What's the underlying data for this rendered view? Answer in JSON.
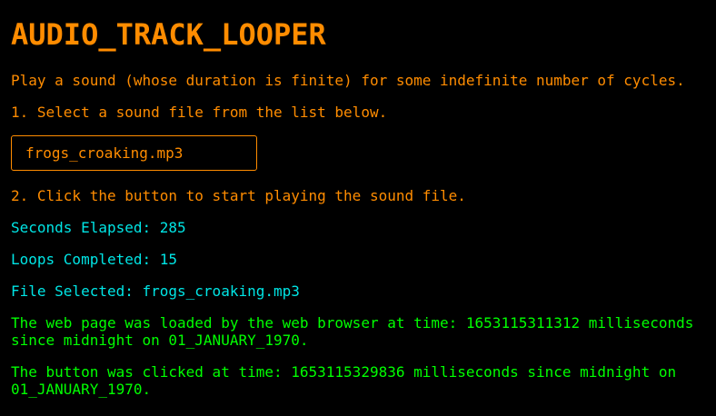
{
  "title": "AUDIO_TRACK_LOOPER",
  "description": "Play a sound (whose duration is finite) for some indefinite number of cycles.",
  "step1": "1. Select a sound file from the list below.",
  "selected_file": "frogs_croaking.mp3",
  "step2": "2. Click the button to start playing the sound file.",
  "seconds_elapsed": "Seconds Elapsed: 285",
  "loops_completed": "Loops Completed: 15",
  "file_selected": "File Selected: frogs_croaking.mp3",
  "page_loaded": "The web page was loaded by the web browser at time: 1653115311312 milliseconds since midnight on 01_JANUARY_1970.",
  "button_clicked": "The button was clicked at time: 1653115329836 milliseconds since midnight on 01_JANUARY_1970.",
  "colors": {
    "background": "#000000",
    "orange": "#ff8c00",
    "cyan": "#00e5e5",
    "green": "#00ff00"
  }
}
